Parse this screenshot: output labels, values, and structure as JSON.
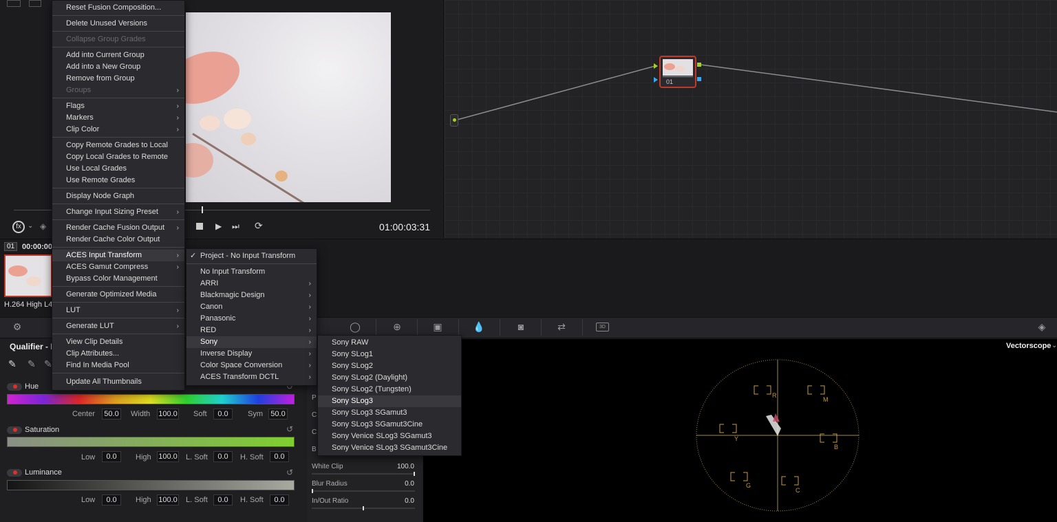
{
  "viewer": {
    "timecode": "01:00:03:31",
    "clip_number": "01",
    "clip_timecode": "00:00:00",
    "clip_codec": "H.264 High L4"
  },
  "node": {
    "label": "01"
  },
  "qualifier": {
    "title": "Qualifier - H",
    "hue": {
      "label": "Hue",
      "center_label": "Center",
      "center": "50.0",
      "width_label": "Width",
      "width": "100.0",
      "soft_label": "Soft",
      "soft": "0.0",
      "sym_label": "Sym",
      "sym": "50.0"
    },
    "saturation": {
      "label": "Saturation",
      "low_label": "Low",
      "low": "0.0",
      "high_label": "High",
      "high": "100.0",
      "lsoft_label": "L. Soft",
      "lsoft": "0.0",
      "hsoft_label": "H. Soft",
      "hsoft": "0.0"
    },
    "luminance": {
      "label": "Luminance",
      "low_label": "Low",
      "low": "0.0",
      "high_label": "High",
      "high": "100.0",
      "lsoft_label": "L. Soft",
      "lsoft": "0.0",
      "hsoft_label": "H. Soft",
      "hsoft": "0.0"
    }
  },
  "matte": {
    "p_label": "P",
    "c1_label": "C",
    "c2_label": "C",
    "b_label": "B",
    "white_clip_label": "White Clip",
    "white_clip": "100.0",
    "blur_radius_label": "Blur Radius",
    "blur_radius": "0.0",
    "inout_ratio_label": "In/Out Ratio",
    "inout_ratio": "0.0"
  },
  "scope": {
    "title": "Vectorscope",
    "targets": [
      "R",
      "M",
      "B",
      "C",
      "G",
      "Y"
    ]
  },
  "menu_main": [
    {
      "label": "Reset Fusion Composition...",
      "sub": false,
      "disabled": false
    },
    {
      "label": "Delete Unused Versions",
      "sub": false,
      "disabled": false
    },
    {
      "label": "Collapse Group Grades",
      "sub": false,
      "disabled": true
    },
    {
      "label": "Add into Current Group",
      "sub": false,
      "disabled": false
    },
    {
      "label": "Add into a New Group",
      "sub": false,
      "disabled": false
    },
    {
      "label": "Remove from Group",
      "sub": false,
      "disabled": false
    },
    {
      "label": "Groups",
      "sub": true,
      "disabled": true
    },
    {
      "label": "Flags",
      "sub": true,
      "disabled": false
    },
    {
      "label": "Markers",
      "sub": true,
      "disabled": false
    },
    {
      "label": "Clip Color",
      "sub": true,
      "disabled": false
    },
    {
      "label": "Copy Remote Grades to Local",
      "sub": false,
      "disabled": false
    },
    {
      "label": "Copy Local Grades to Remote",
      "sub": false,
      "disabled": false
    },
    {
      "label": "Use Local Grades",
      "sub": false,
      "disabled": false
    },
    {
      "label": "Use Remote Grades",
      "sub": false,
      "disabled": false
    },
    {
      "label": "Display Node Graph",
      "sub": false,
      "disabled": false
    },
    {
      "label": "Change Input Sizing Preset",
      "sub": true,
      "disabled": false
    },
    {
      "label": "Render Cache Fusion Output",
      "sub": true,
      "disabled": false
    },
    {
      "label": "Render Cache Color Output",
      "sub": false,
      "disabled": false
    },
    {
      "label": "ACES Input Transform",
      "sub": true,
      "disabled": false
    },
    {
      "label": "ACES Gamut Compress",
      "sub": true,
      "disabled": false
    },
    {
      "label": "Bypass Color Management",
      "sub": false,
      "disabled": false
    },
    {
      "label": "Generate Optimized Media",
      "sub": false,
      "disabled": false
    },
    {
      "label": "LUT",
      "sub": true,
      "disabled": false
    },
    {
      "label": "Generate LUT",
      "sub": true,
      "disabled": false
    },
    {
      "label": "View Clip Details",
      "sub": false,
      "disabled": false
    },
    {
      "label": "Clip Attributes...",
      "sub": false,
      "disabled": false
    },
    {
      "label": "Find In Media Pool",
      "sub": false,
      "disabled": false
    },
    {
      "label": "Update All Thumbnails",
      "sub": false,
      "disabled": false
    }
  ],
  "menu_aces": [
    {
      "label": "Project - No Input Transform",
      "sub": false,
      "checked": true
    },
    {
      "label": "No Input Transform",
      "sub": false,
      "checked": false
    },
    {
      "label": "ARRI",
      "sub": true,
      "checked": false
    },
    {
      "label": "Blackmagic Design",
      "sub": true,
      "checked": false
    },
    {
      "label": "Canon",
      "sub": true,
      "checked": false
    },
    {
      "label": "Panasonic",
      "sub": true,
      "checked": false
    },
    {
      "label": "RED",
      "sub": true,
      "checked": false
    },
    {
      "label": "Sony",
      "sub": true,
      "checked": false
    },
    {
      "label": "Inverse Display",
      "sub": true,
      "checked": false
    },
    {
      "label": "Color Space Conversion",
      "sub": true,
      "checked": false
    },
    {
      "label": "ACES Transform DCTL",
      "sub": true,
      "checked": false
    }
  ],
  "menu_sony": [
    "Sony RAW",
    "Sony SLog1",
    "Sony SLog2",
    "Sony SLog2 (Daylight)",
    "Sony SLog2 (Tungsten)",
    "Sony SLog3",
    "Sony SLog3 SGamut3",
    "Sony SLog3 SGamut3Cine",
    "Sony Venice SLog3 SGamut3",
    "Sony Venice SLog3 SGamut3Cine"
  ],
  "glyphs": {
    "arrow": "›",
    "check": "✓",
    "reset": "↺"
  }
}
